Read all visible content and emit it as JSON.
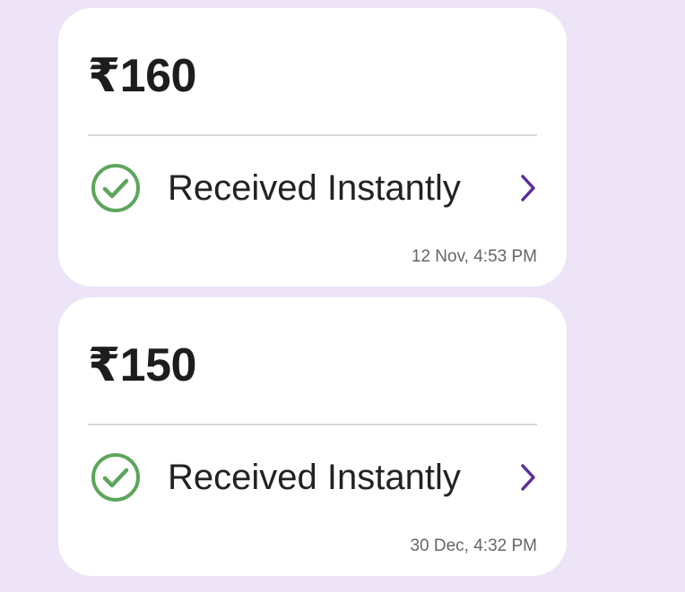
{
  "colors": {
    "background": "#ede4f7",
    "card": "#ffffff",
    "success": "#5da55b",
    "accent": "#5b2d9a"
  },
  "transactions": [
    {
      "amount": "₹160",
      "status_label": "Received Instantly",
      "status_icon": "check-circle-icon",
      "timestamp": "12 Nov, 4:53 PM"
    },
    {
      "amount": "₹150",
      "status_label": "Received Instantly",
      "status_icon": "check-circle-icon",
      "timestamp": "30 Dec, 4:32 PM"
    }
  ]
}
